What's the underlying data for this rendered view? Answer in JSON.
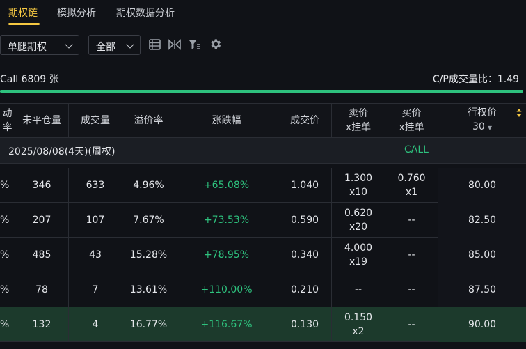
{
  "tabs": [
    {
      "label": "期权链"
    },
    {
      "label": "模拟分析"
    },
    {
      "label": "期权数据分析"
    }
  ],
  "toolbar": {
    "type_select": "单腿期权",
    "filter_select": "全部"
  },
  "summary": {
    "call_count": "Call 6809 张",
    "cp_ratio": "C/P成交量比：1.49",
    "call_fraction": 1.0
  },
  "columns": {
    "c0": "动率",
    "c1": "未平仓量",
    "c2": "成交量",
    "c3": "溢价率",
    "c4": "涨跌幅",
    "c5": "成交价",
    "c6": "卖价\nx挂单",
    "c7": "买价\nx挂单",
    "c8": "行权价",
    "c8_sub": "30"
  },
  "group": {
    "date": "2025/08/08(4天)(周权)",
    "side": "CALL"
  },
  "rows": [
    {
      "c0": "%",
      "oi": "346",
      "vol": "633",
      "prem": "4.96%",
      "chg": "+65.08%",
      "last": "1.040",
      "ask": "1.300\nx10",
      "bid": "0.760\nx1",
      "strike": "80.00"
    },
    {
      "c0": "%",
      "oi": "207",
      "vol": "107",
      "prem": "7.67%",
      "chg": "+73.53%",
      "last": "0.590",
      "ask": "0.620\nx20",
      "bid": "--",
      "strike": "82.50"
    },
    {
      "c0": "%",
      "oi": "485",
      "vol": "43",
      "prem": "15.28%",
      "chg": "+78.95%",
      "last": "0.340",
      "ask": "4.000\nx19",
      "bid": "--",
      "strike": "85.00"
    },
    {
      "c0": "%",
      "oi": "78",
      "vol": "7",
      "prem": "13.61%",
      "chg": "+110.00%",
      "last": "0.210",
      "ask": "--",
      "bid": "--",
      "strike": "87.50"
    },
    {
      "c0": "%",
      "oi": "132",
      "vol": "4",
      "prem": "16.77%",
      "chg": "+116.67%",
      "last": "0.130",
      "ask": "0.150\nx2",
      "bid": "--",
      "strike": "90.00"
    }
  ],
  "colors": {
    "accent": "#f5c842",
    "up": "#2ec27e",
    "highlight_row": "#1c3a2c"
  }
}
